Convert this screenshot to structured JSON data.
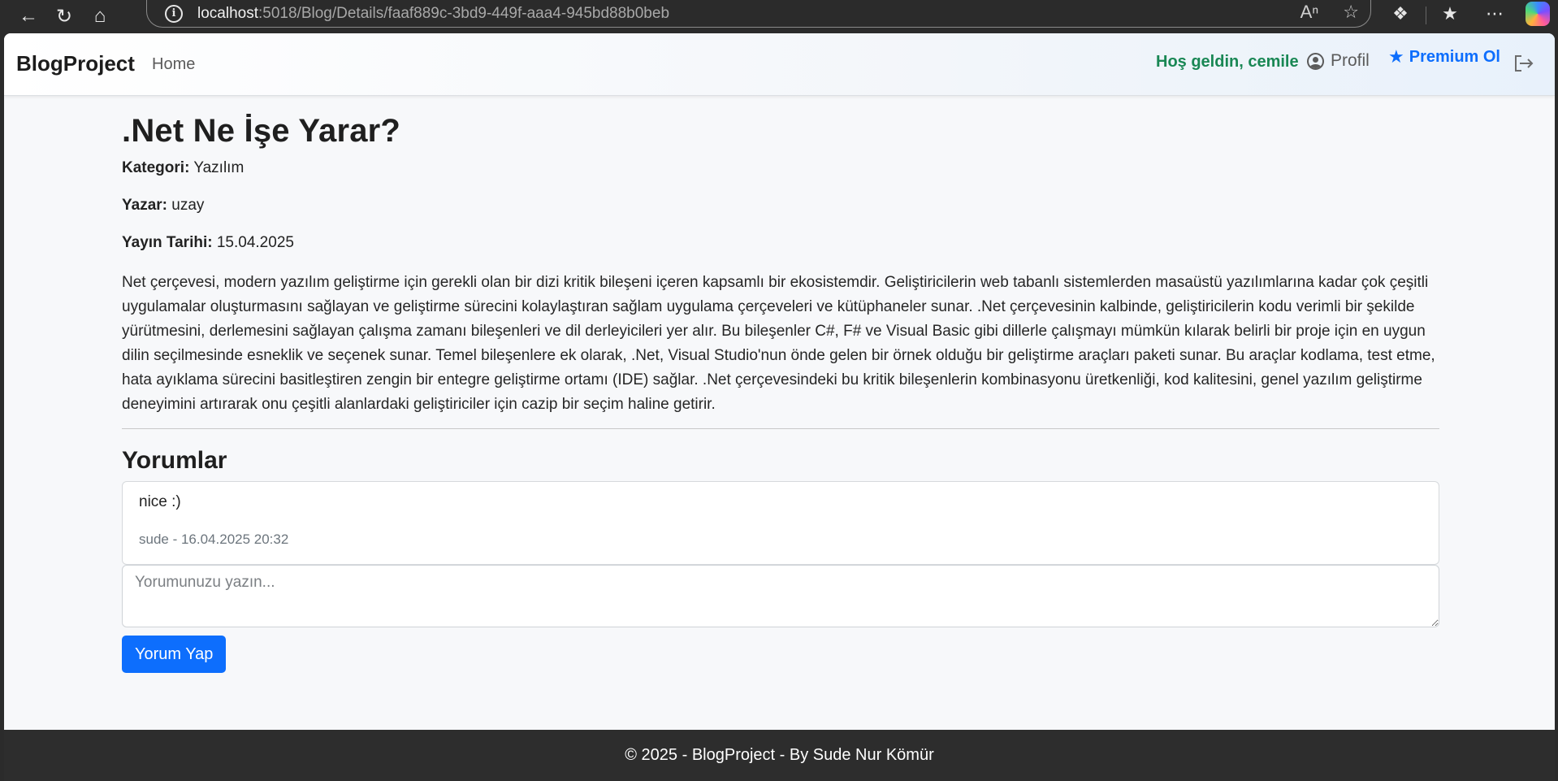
{
  "browser": {
    "url_host": "localhost",
    "url_rest": ":5018/Blog/Details/faaf889c-3bd9-449f-aaa4-945bd88b0beb"
  },
  "navbar": {
    "brand": "BlogProject",
    "home_label": "Home",
    "welcome": "Hoş geldin, cemile",
    "profile_label": "Profil",
    "premium_label": "Premium Ol"
  },
  "post": {
    "title": ".Net Ne İşe Yarar?",
    "category_label": "Kategori:",
    "category": "Yazılım",
    "author_label": "Yazar:",
    "author": "uzay",
    "date_label": "Yayın Tarihi:",
    "date": "15.04.2025",
    "body": "Net çerçevesi, modern yazılım geliştirme için gerekli olan bir dizi kritik bileşeni içeren kapsamlı bir ekosistemdir. Geliştiricilerin web tabanlı sistemlerden masaüstü yazılımlarına kadar çok çeşitli uygulamalar oluşturmasını sağlayan ve geliştirme sürecini kolaylaştıran sağlam uygulama çerçeveleri ve kütüphaneler sunar. .Net çerçevesinin kalbinde, geliştiricilerin kodu verimli bir şekilde yürütmesini, derlemesini sağlayan çalışma zamanı bileşenleri ve dil derleyicileri yer alır. Bu bileşenler C#, F# ve Visual Basic gibi dillerle çalışmayı mümkün kılarak belirli bir proje için en uygun dilin seçilmesinde esneklik ve seçenek sunar. Temel bileşenlere ek olarak, .Net, Visual Studio'nun önde gelen bir örnek olduğu bir geliştirme araçları paketi sunar. Bu araçlar kodlama, test etme, hata ayıklama sürecini basitleştiren zengin bir entegre geliştirme ortamı (IDE) sağlar. .Net çerçevesindeki bu kritik bileşenlerin kombinasyonu üretkenliği, kod kalitesini, genel yazılım geliştirme deneyimini artırarak onu çeşitli alanlardaki geliştiriciler için cazip bir seçim haline getirir."
  },
  "comments": {
    "heading": "Yorumlar",
    "items": [
      {
        "text": "nice :)",
        "meta": "sude - 16.04.2025 20:32"
      }
    ],
    "input_placeholder": "Yorumunuzu yazın...",
    "submit_label": "Yorum Yap"
  },
  "footer": {
    "text": "© 2025 - BlogProject - By Sude Nur Kömür"
  },
  "colors": {
    "primary": "#0d6efd",
    "success": "#198754",
    "footer_bg": "#2d2d2d"
  }
}
